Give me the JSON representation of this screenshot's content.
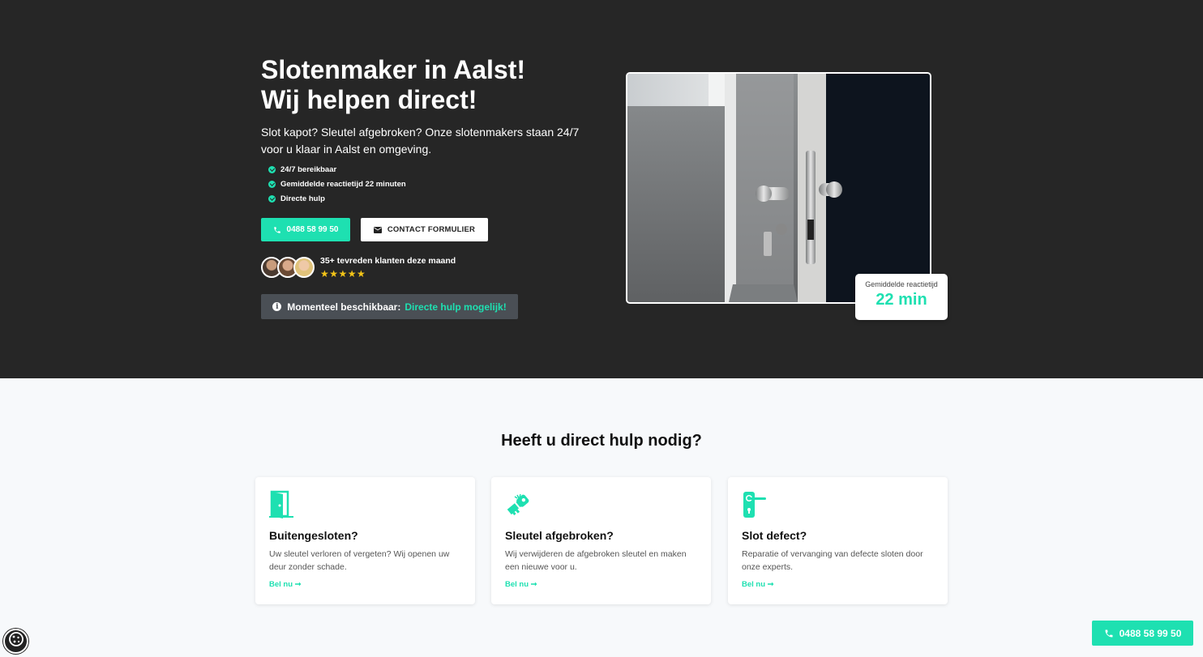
{
  "hero": {
    "title_line1": "Slotenmaker in Aalst!",
    "title_line2": "Wij helpen direct!",
    "subtitle": "Slot kapot? Sleutel afgebroken? Onze slotenmakers staan 24/7 voor u klaar in Aalst en omgeving.",
    "checklist": [
      "24/7 bereikbaar",
      "Gemiddelde reactietijd 22 minuten",
      "Directe hulp"
    ],
    "call_button": {
      "label": "0488 58 99 50",
      "icon": "phone-icon"
    },
    "contact_button": {
      "label": "CONTACT FORMULIER",
      "icon": "mail-icon"
    },
    "reviews": {
      "text": "35+ tevreden klanten deze maand",
      "stars": "★★★★★",
      "rating": 5
    },
    "availability": {
      "prefix": "Momenteel beschikbaar:",
      "highlight": "Directe hulp mogelijk!",
      "icon": "info-icon"
    },
    "reaction_card": {
      "label": "Gemiddelde reactietijd",
      "value": "22 min"
    }
  },
  "services": {
    "title": "Heeft u direct hulp nodig?",
    "cards": [
      {
        "icon": "door-icon",
        "title": "Buitengesloten?",
        "text": "Uw sleutel verloren of vergeten? Wij openen uw deur zonder schade.",
        "link": "Bel nu ➞"
      },
      {
        "icon": "broken-key-icon",
        "title": "Sleutel afgebroken?",
        "text": "Wij verwijderen de afgebroken sleutel en maken een nieuwe voor u.",
        "link": "Bel nu ➞"
      },
      {
        "icon": "door-handle-icon",
        "title": "Slot defect?",
        "text": "Reparatie of vervanging van defecte sloten door onze experts.",
        "link": "Bel nu ➞"
      }
    ]
  },
  "floating_call": {
    "label": "0488 58 99 50",
    "icon": "phone-icon"
  },
  "cookie_button": {
    "icon": "cookie-icon"
  },
  "colors": {
    "accent": "#1ee0b1",
    "hero_bg": "#262626",
    "page_bg": "#f7f9fb"
  }
}
